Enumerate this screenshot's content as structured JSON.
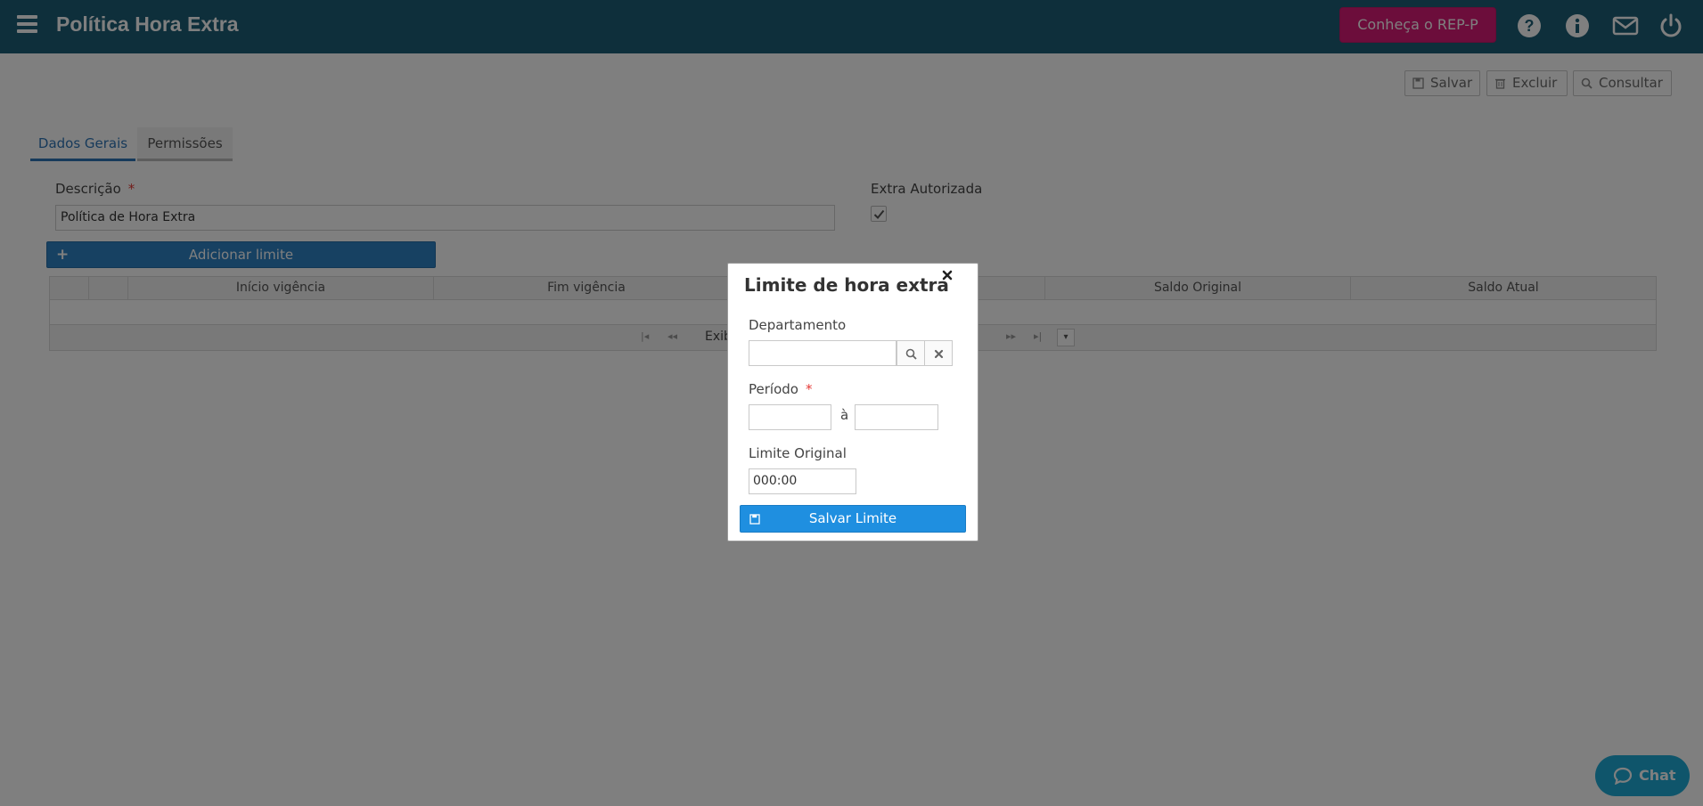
{
  "header": {
    "title": "Política Hora Extra",
    "promo_label": "Conheça o REP-P",
    "icons": [
      "menu-icon",
      "help-icon",
      "info-icon",
      "mail-icon",
      "power-icon"
    ]
  },
  "toolbar": {
    "save_label": "Salvar",
    "delete_label": "Excluir",
    "query_label": "Consultar"
  },
  "tabs": [
    {
      "label": "Dados Gerais",
      "active": true
    },
    {
      "label": "Permissões",
      "active": false
    }
  ],
  "form": {
    "description_label": "Descrição",
    "description_value": "Política de Hora Extra",
    "extra_authorized_label": "Extra Autorizada",
    "extra_authorized_checked": true,
    "add_limit_label": "Adicionar limite"
  },
  "grid": {
    "columns": [
      "",
      "",
      "Início vigência",
      "Fim vigência",
      "",
      "Saldo Original",
      "Saldo Atual"
    ],
    "pager_text": "Exib"
  },
  "modal": {
    "title": "Limite de hora extra",
    "department_label": "Departamento",
    "department_value": "",
    "period_label": "Período",
    "period_separator": "à",
    "period_start": "",
    "period_end": "",
    "original_limit_label": "Limite Original",
    "original_limit_value": "000:00",
    "save_label": "Salvar Limite"
  },
  "chat": {
    "label": "Chat"
  },
  "colors": {
    "topbar": "#1d5f76",
    "promo": "#d81b76",
    "primary": "#2f83c5",
    "modal_primary": "#1f8fe0",
    "chat": "#1eaad6",
    "required": "#e53935"
  }
}
